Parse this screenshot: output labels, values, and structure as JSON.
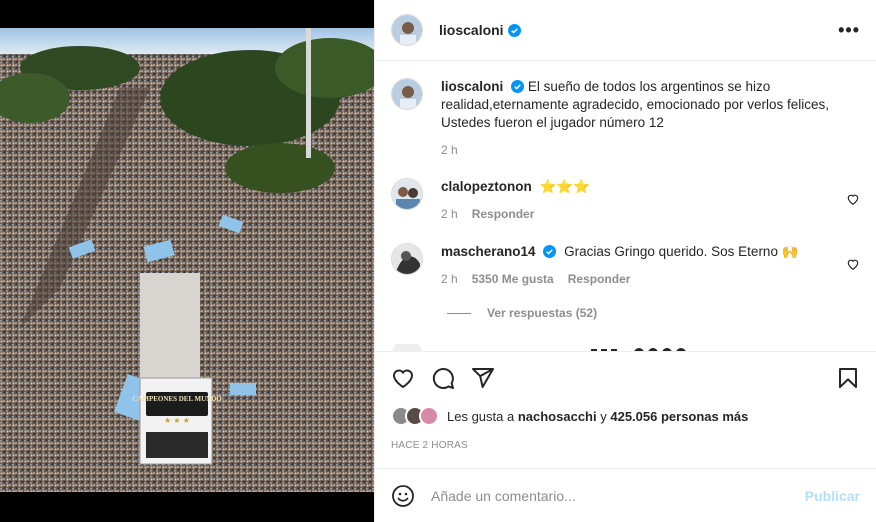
{
  "post": {
    "author": "lioscaloni",
    "caption": "El sueño de todos los argentinos se hizo realidad,eternamente agradecido, emocionado por verlos felices, Ustedes fueron el jugador número 12",
    "caption_time": "2 h"
  },
  "media": {
    "bus_text": "CAMPEONES DEL MUNDO"
  },
  "comments": [
    {
      "user": "clalopeztonon",
      "text": "⭐⭐⭐",
      "time": "2 h",
      "reply": "Responder"
    },
    {
      "user": "mascherano14",
      "text": "Gracias Gringo querido. Sos Eterno 🙌",
      "time": "2 h",
      "likes": "5350 Me gusta",
      "reply": "Responder",
      "replies_label": "Ver respuestas (52)"
    }
  ],
  "likes": {
    "prefix": "Les gusta a",
    "user": "nachosacchi",
    "middle": "y",
    "count": "425.056 personas más"
  },
  "time_ago": "HACE 2 HORAS",
  "composer": {
    "placeholder": "Añade un comentario...",
    "publish": "Publicar"
  },
  "colors": {
    "verified": "#0095f6",
    "publish": "#b2dffc",
    "meta": "#8e8e8e"
  },
  "icons": [
    "more-icon",
    "heart-icon",
    "comment-icon",
    "share-icon",
    "bookmark-icon",
    "emoji-icon",
    "verified-icon"
  ]
}
